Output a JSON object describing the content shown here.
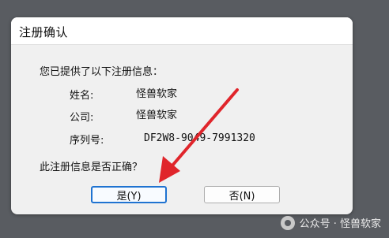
{
  "dialog": {
    "title": "注册确认",
    "intro": "您已提供了以下注册信息：",
    "fields": [
      {
        "label": "姓名:",
        "value": "怪兽软家"
      },
      {
        "label": "公司:",
        "value": "怪兽软家"
      },
      {
        "label": "序列号:",
        "value": "DF2W8-9049-7991320"
      }
    ],
    "question": "此注册信息是否正确？",
    "yes_label": "是(Y)",
    "no_label": "否(N)"
  },
  "watermark": {
    "text": "公众号 · 怪兽软家",
    "icon": "wechat-icon"
  },
  "annotation": {
    "arrow_color": "#e0252b"
  }
}
